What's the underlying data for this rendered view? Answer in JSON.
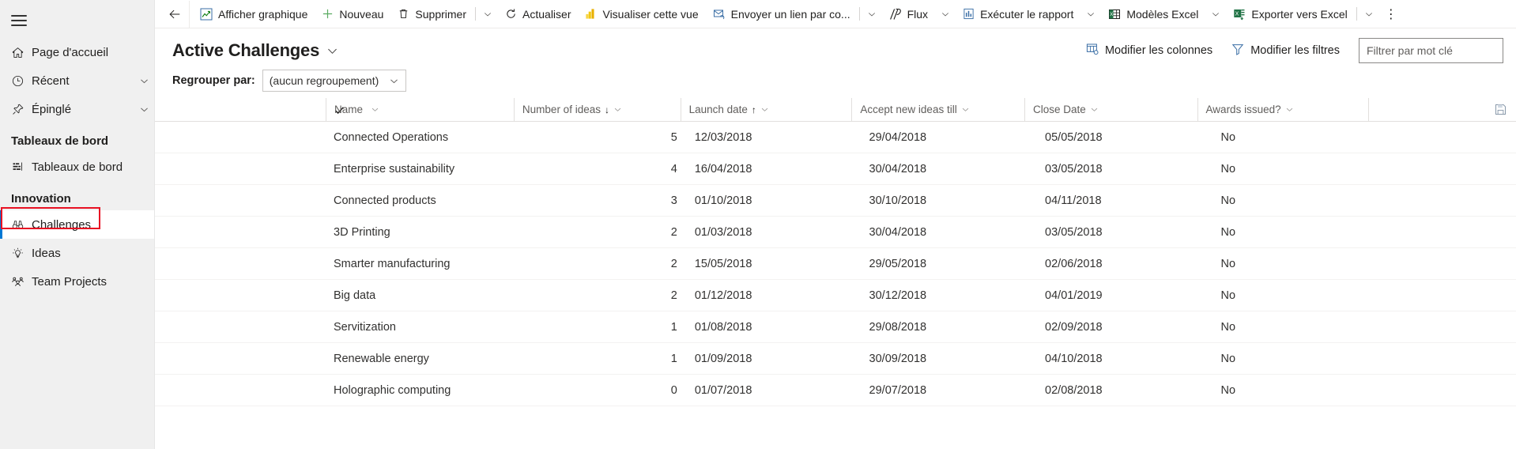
{
  "sidebar": {
    "menu_icon": "hamburger-icon",
    "items": [
      {
        "label": "Page d'accueil",
        "icon": "home-icon",
        "chevron": false
      },
      {
        "label": "Récent",
        "icon": "clock-icon",
        "chevron": true
      },
      {
        "label": "Épinglé",
        "icon": "pin-icon",
        "chevron": true
      }
    ],
    "groups": [
      {
        "title": "Tableaux de bord",
        "items": [
          {
            "label": "Tableaux de bord",
            "icon": "dashboard-icon",
            "selected": false
          }
        ]
      },
      {
        "title": "Innovation",
        "items": [
          {
            "label": "Challenges",
            "icon": "binoculars-icon",
            "selected": true
          },
          {
            "label": "Ideas",
            "icon": "lightbulb-icon",
            "selected": false
          },
          {
            "label": "Team Projects",
            "icon": "people-icon",
            "selected": false
          }
        ]
      }
    ],
    "highlight_color": "#e81123",
    "selected_accent": "#0078d4"
  },
  "commandbar": {
    "back": "back-arrow-icon",
    "commands": [
      {
        "label": "Afficher graphique",
        "icon": "chart-icon",
        "caret": false,
        "divider": false
      },
      {
        "label": "Nouveau",
        "icon": "plus-icon",
        "caret": false,
        "divider": false
      },
      {
        "label": "Supprimer",
        "icon": "trash-icon",
        "caret": true,
        "divider": true
      },
      {
        "label": "Actualiser",
        "icon": "refresh-icon",
        "caret": false,
        "divider": false
      },
      {
        "label": "Visualiser cette vue",
        "icon": "powerbi-icon",
        "caret": false,
        "divider": false
      },
      {
        "label": "Envoyer un lien par co...",
        "icon": "email-link-icon",
        "caret": true,
        "divider": true
      },
      {
        "label": "Flux",
        "icon": "flow-icon",
        "caret": true,
        "divider": false
      },
      {
        "label": "Exécuter le rapport",
        "icon": "report-icon",
        "caret": true,
        "divider": false
      },
      {
        "label": "Modèles Excel",
        "icon": "excel-template-icon",
        "caret": true,
        "divider": false
      },
      {
        "label": "Exporter vers Excel",
        "icon": "excel-export-icon",
        "caret": true,
        "divider": true
      }
    ],
    "overflow": "⋮"
  },
  "header": {
    "title": "Active Challenges",
    "title_caret": "chevron-down-icon",
    "edit_columns": "Modifier les colonnes",
    "edit_columns_icon": "columns-icon",
    "edit_filters": "Modifier les filtres",
    "edit_filters_icon": "filter-icon",
    "search_placeholder": "Filtrer par mot clé",
    "search_value": ""
  },
  "groupby": {
    "label": "Regrouper par:",
    "value": "(aucun regroupement)",
    "caret": "chevron-down-icon"
  },
  "grid": {
    "select_all_icon": "checkmark-icon",
    "save_icon": "save-icon",
    "columns": [
      {
        "label": "Name",
        "sort": ""
      },
      {
        "label": "Number of ideas",
        "sort": "↓"
      },
      {
        "label": "Launch date",
        "sort": "↑"
      },
      {
        "label": "Accept new ideas till",
        "sort": ""
      },
      {
        "label": "Close Date",
        "sort": ""
      },
      {
        "label": "Awards issued?",
        "sort": ""
      }
    ],
    "rows": [
      {
        "name": "Connected Operations",
        "ideas": "5",
        "launch": "12/03/2018",
        "accept": "29/04/2018",
        "close": "05/05/2018",
        "awards": "No"
      },
      {
        "name": "Enterprise sustainability",
        "ideas": "4",
        "launch": "16/04/2018",
        "accept": "30/04/2018",
        "close": "03/05/2018",
        "awards": "No"
      },
      {
        "name": "Connected products",
        "ideas": "3",
        "launch": "01/10/2018",
        "accept": "30/10/2018",
        "close": "04/11/2018",
        "awards": "No"
      },
      {
        "name": "3D Printing",
        "ideas": "2",
        "launch": "01/03/2018",
        "accept": "30/04/2018",
        "close": "03/05/2018",
        "awards": "No"
      },
      {
        "name": "Smarter manufacturing",
        "ideas": "2",
        "launch": "15/05/2018",
        "accept": "29/05/2018",
        "close": "02/06/2018",
        "awards": "No"
      },
      {
        "name": "Big data",
        "ideas": "2",
        "launch": "01/12/2018",
        "accept": "30/12/2018",
        "close": "04/01/2019",
        "awards": "No"
      },
      {
        "name": "Servitization",
        "ideas": "1",
        "launch": "01/08/2018",
        "accept": "29/08/2018",
        "close": "02/09/2018",
        "awards": "No"
      },
      {
        "name": "Renewable energy",
        "ideas": "1",
        "launch": "01/09/2018",
        "accept": "30/09/2018",
        "close": "04/10/2018",
        "awards": "No"
      },
      {
        "name": "Holographic computing",
        "ideas": "0",
        "launch": "01/07/2018",
        "accept": "29/07/2018",
        "close": "02/08/2018",
        "awards": "No"
      }
    ]
  }
}
